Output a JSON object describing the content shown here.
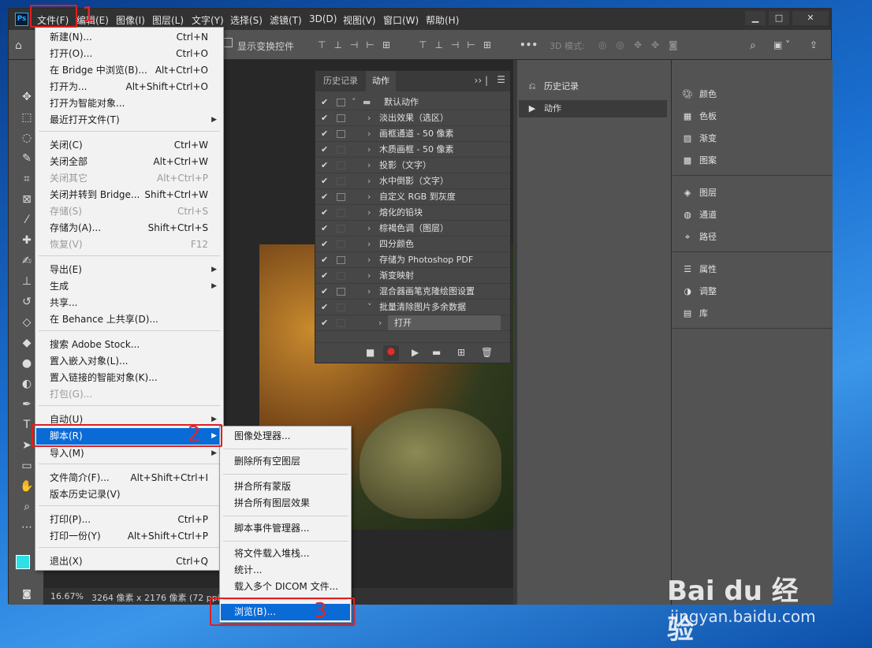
{
  "app": {
    "logo": "Ps"
  },
  "menubar": [
    "文件(F)",
    "编辑(E)",
    "图像(I)",
    "图层(L)",
    "文字(Y)",
    "选择(S)",
    "滤镜(T)",
    "3D(D)",
    "视图(V)",
    "窗口(W)",
    "帮助(H)"
  ],
  "window_controls": {
    "min": "▁",
    "max": "□",
    "close": "✕"
  },
  "options_bar": {
    "transform": "显示变换控件",
    "mode3d": "3D 模式:"
  },
  "status": {
    "zoom": "16.67%",
    "info": "3264 像素 x 2176 像素 (72 ppi)"
  },
  "file_menu": [
    {
      "label": "新建(N)...",
      "shortcut": "Ctrl+N"
    },
    {
      "label": "打开(O)...",
      "shortcut": "Ctrl+O"
    },
    {
      "label": "在 Bridge 中浏览(B)...",
      "shortcut": "Alt+Ctrl+O"
    },
    {
      "label": "打开为...",
      "shortcut": "Alt+Shift+Ctrl+O"
    },
    {
      "label": "打开为智能对象...",
      "shortcut": ""
    },
    {
      "label": "最近打开文件(T)",
      "shortcut": ""
    },
    {
      "label": "关闭(C)",
      "shortcut": "Ctrl+W"
    },
    {
      "label": "关闭全部",
      "shortcut": "Alt+Ctrl+W"
    },
    {
      "label": "关闭其它",
      "shortcut": "Alt+Ctrl+P"
    },
    {
      "label": "关闭并转到 Bridge...",
      "shortcut": "Shift+Ctrl+W"
    },
    {
      "label": "存储(S)",
      "shortcut": "Ctrl+S"
    },
    {
      "label": "存储为(A)...",
      "shortcut": "Shift+Ctrl+S"
    },
    {
      "label": "恢复(V)",
      "shortcut": "F12"
    },
    {
      "label": "导出(E)",
      "shortcut": ""
    },
    {
      "label": "生成",
      "shortcut": ""
    },
    {
      "label": "共享...",
      "shortcut": ""
    },
    {
      "label": "在 Behance 上共享(D)...",
      "shortcut": ""
    },
    {
      "label": "搜索 Adobe Stock...",
      "shortcut": ""
    },
    {
      "label": "置入嵌入对象(L)...",
      "shortcut": ""
    },
    {
      "label": "置入链接的智能对象(K)...",
      "shortcut": ""
    },
    {
      "label": "打包(G)...",
      "shortcut": ""
    },
    {
      "label": "自动(U)",
      "shortcut": ""
    },
    {
      "label": "脚本(R)",
      "shortcut": ""
    },
    {
      "label": "导入(M)",
      "shortcut": ""
    },
    {
      "label": "文件简介(F)...",
      "shortcut": "Alt+Shift+Ctrl+I"
    },
    {
      "label": "版本历史记录(V)",
      "shortcut": ""
    },
    {
      "label": "打印(P)...",
      "shortcut": "Ctrl+P"
    },
    {
      "label": "打印一份(Y)",
      "shortcut": "Alt+Shift+Ctrl+P"
    },
    {
      "label": "退出(X)",
      "shortcut": "Ctrl+Q"
    }
  ],
  "scripts_menu": [
    "图像处理器...",
    "删除所有空图层",
    "拼合所有蒙版",
    "拼合所有图层效果",
    "脚本事件管理器...",
    "将文件载入堆栈...",
    "统计...",
    "载入多个 DICOM 文件...",
    "浏览(B)..."
  ],
  "actions_panel": {
    "tabs": [
      "历史记录",
      "动作"
    ],
    "set": "默认动作",
    "actions": [
      "淡出效果（选区）",
      "画框通道 - 50 像素",
      "木质画框 - 50 像素",
      "投影（文字）",
      "水中倒影（文字）",
      "自定义 RGB 到灰度",
      "熔化的铅块",
      "棕褐色调（图层）",
      "四分颜色",
      "存储为 Photoshop PDF",
      "渐变映射",
      "混合器画笔克隆绘图设置",
      "批量清除图片多余数据"
    ],
    "step": "打开"
  },
  "mid_panel": [
    "历史记录",
    "动作"
  ],
  "right_panel": [
    "颜色",
    "色板",
    "渐变",
    "图案",
    "图层",
    "通道",
    "路径",
    "属性",
    "调整",
    "库"
  ],
  "annotations": [
    "1",
    "2",
    "3"
  ],
  "watermark": {
    "brand": "Bai du 经验",
    "url": "jingyan.baidu.com"
  },
  "colors": {
    "menu_highlight": "#0a6bd7",
    "annotation": "#e02020",
    "foreground_swatch": "#2de0e6"
  }
}
